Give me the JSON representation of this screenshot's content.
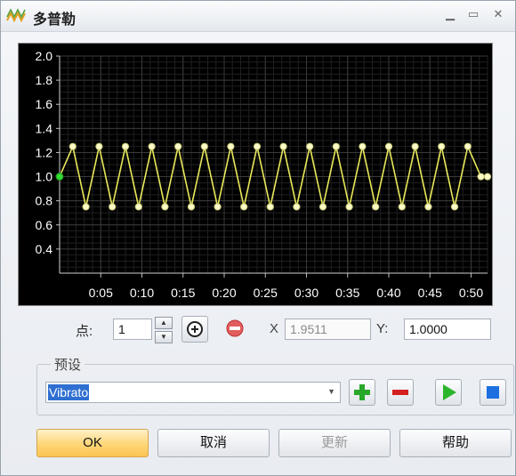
{
  "window": {
    "title": "多普勒"
  },
  "chart_data": {
    "type": "line",
    "y_ticks": [
      "2.0",
      "1.8",
      "1.6",
      "1.4",
      "1.2",
      "1.0",
      "0.8",
      "0.6",
      "0.4"
    ],
    "x_ticks": [
      "0:05",
      "0:10",
      "0:15",
      "0:20",
      "0:25",
      "0:30",
      "0:35",
      "0:40",
      "0:45",
      "0:50"
    ],
    "ylim": [
      0.2,
      2.0
    ],
    "xlim": [
      0,
      52
    ],
    "grid": true,
    "colors": {
      "line": "#e8e85a",
      "point": "#fbfbc8",
      "selected_point": "#33dd33",
      "grid": "#3a3a3a",
      "axis_text": "#ffffff"
    },
    "x": [
      0,
      1.6,
      3.2,
      4.8,
      6.4,
      8.0,
      9.6,
      11.2,
      12.8,
      14.4,
      16.0,
      17.6,
      19.2,
      20.8,
      22.4,
      24.0,
      25.6,
      27.2,
      28.8,
      30.4,
      32.0,
      33.6,
      35.2,
      36.8,
      38.4,
      40.0,
      41.6,
      43.2,
      44.8,
      46.4,
      48.0,
      49.6,
      51.2,
      52.0
    ],
    "y": [
      1.0,
      1.25,
      0.75,
      1.25,
      0.75,
      1.25,
      0.75,
      1.25,
      0.75,
      1.25,
      0.75,
      1.25,
      0.75,
      1.25,
      0.75,
      1.25,
      0.75,
      1.25,
      0.75,
      1.25,
      0.75,
      1.25,
      0.75,
      1.25,
      0.75,
      1.25,
      0.75,
      1.25,
      0.75,
      1.25,
      0.75,
      1.25,
      1.0,
      1.0
    ],
    "selected_index": 0
  },
  "point_row": {
    "point_label": "点:",
    "point_value": "1",
    "x_label": "X",
    "x_value": "1.9511",
    "y_label": "Y:",
    "y_value": "1.0000"
  },
  "preset": {
    "legend": "预设",
    "selected": "Vibrato"
  },
  "buttons": {
    "ok": "OK",
    "cancel": "取消",
    "update": "更新",
    "help": "帮助"
  }
}
